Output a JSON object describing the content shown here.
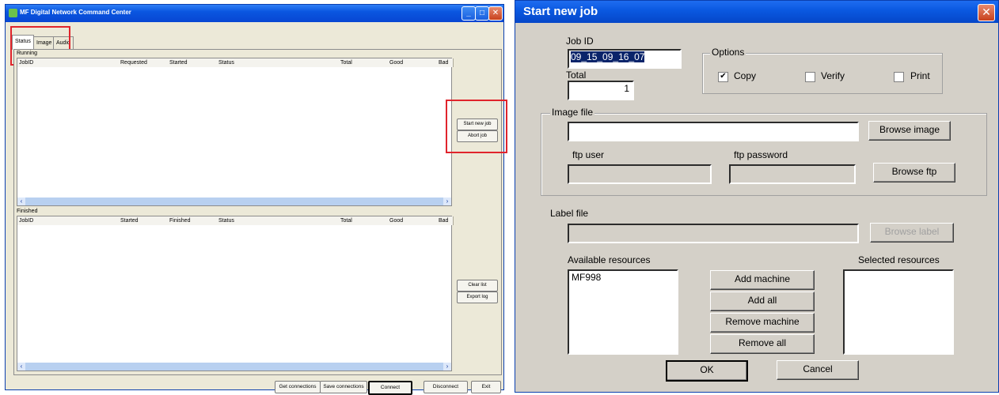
{
  "main_window": {
    "title": "MF Digital Network Command Center",
    "controls": {
      "minimize": "_",
      "maximize": "□",
      "close": "✕"
    },
    "tabs": [
      "Status",
      "Image",
      "Audio"
    ],
    "running": {
      "label": "Running",
      "columns": [
        "JobID",
        "Requested",
        "Started",
        "Status",
        "Total",
        "Good",
        "Bad"
      ]
    },
    "finished": {
      "label": "Finished",
      "columns": [
        "JobID",
        "Started",
        "Finished",
        "Status",
        "Total",
        "Good",
        "Bad"
      ]
    },
    "side_buttons": {
      "start_new_job": "Start new job",
      "abort_job": "Abort job",
      "clear_list": "Clear list",
      "export_log": "Export log"
    },
    "bottom_buttons": {
      "get_connections": "Get connections",
      "save_connections": "Save connections",
      "connect": "Connect",
      "disconnect": "Disconnect",
      "exit": "Exit"
    },
    "scroll_arrows": {
      "left": "‹",
      "right": "›"
    },
    "highlight_color": "#e0242c"
  },
  "dialog": {
    "title": "Start new job",
    "close": "✕",
    "job_id": {
      "label": "Job ID",
      "value": "09_15_09_16_07"
    },
    "total": {
      "label": "Total",
      "value": "1"
    },
    "options": {
      "label": "Options",
      "copy": {
        "label": "Copy",
        "checked": true,
        "mark": "✔"
      },
      "verify": {
        "label": "Verify",
        "checked": false
      },
      "print": {
        "label": "Print",
        "checked": false
      }
    },
    "image_file": {
      "label": "Image file",
      "value": "",
      "browse_image": "Browse image",
      "ftp_user_label": "ftp user",
      "ftp_password_label": "ftp password",
      "browse_ftp": "Browse ftp"
    },
    "label_file": {
      "label": "Label file",
      "value": "",
      "browse_label": "Browse label"
    },
    "available_resources": {
      "label": "Available resources",
      "items": [
        "MF998"
      ]
    },
    "selected_resources": {
      "label": "Selected resources",
      "items": []
    },
    "resource_buttons": {
      "add_machine": "Add machine",
      "add_all": "Add all",
      "remove_machine": "Remove machine",
      "remove_all": "Remove all"
    },
    "ok": "OK",
    "cancel": "Cancel"
  }
}
